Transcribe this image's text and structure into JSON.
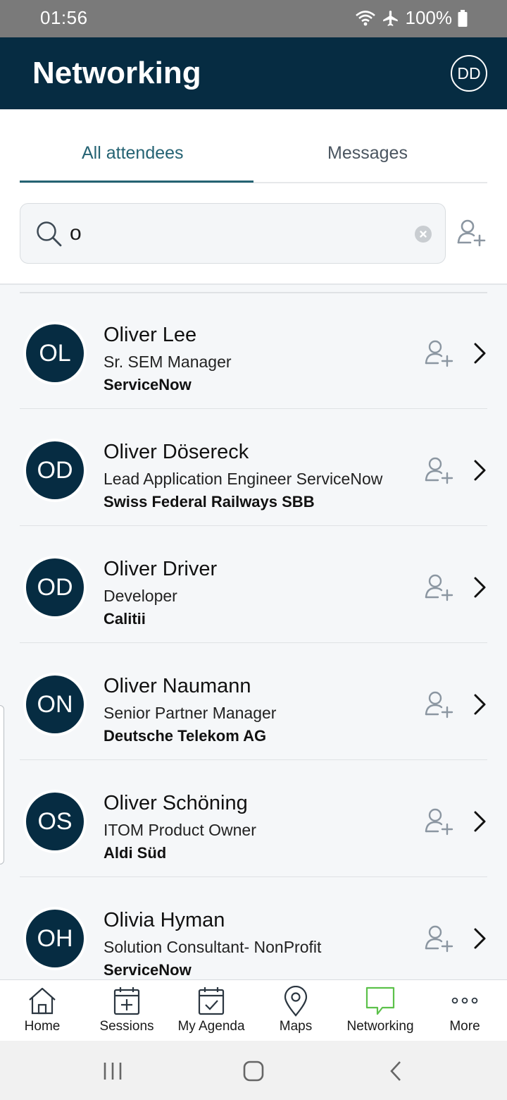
{
  "status_bar": {
    "time": "01:56",
    "battery": "100%"
  },
  "header": {
    "title": "Networking",
    "avatar_initials": "DD"
  },
  "tabs": [
    {
      "label": "All attendees",
      "active": true
    },
    {
      "label": "Messages",
      "active": false
    }
  ],
  "search": {
    "value": "o",
    "placeholder": ""
  },
  "attendees": [
    {
      "initials": "OL",
      "name": "Oliver Lee",
      "role": "Sr. SEM Manager",
      "company": "ServiceNow"
    },
    {
      "initials": "OD",
      "name": "Oliver Dösereck",
      "role": "Lead Application Engineer ServiceNow",
      "company": "Swiss Federal Railways SBB"
    },
    {
      "initials": "OD",
      "name": "Oliver Driver",
      "role": "Developer",
      "company": "Calitii"
    },
    {
      "initials": "ON",
      "name": "Oliver Naumann",
      "role": "Senior Partner Manager",
      "company": "Deutsche Telekom AG"
    },
    {
      "initials": "OS",
      "name": "Oliver Schöning",
      "role": "ITOM Product Owner",
      "company": "Aldi Süd"
    },
    {
      "initials": "OH",
      "name": "Olivia Hyman",
      "role": "Solution Consultant- NonProfit",
      "company": "ServiceNow"
    }
  ],
  "bottom_nav": [
    {
      "label": "Home",
      "icon": "home-icon",
      "active": false
    },
    {
      "label": "Sessions",
      "icon": "calendar-plus-icon",
      "active": false
    },
    {
      "label": "My Agenda",
      "icon": "calendar-check-icon",
      "active": false
    },
    {
      "label": "Maps",
      "icon": "map-pin-icon",
      "active": false
    },
    {
      "label": "Networking",
      "icon": "chat-bubble-icon",
      "active": true
    },
    {
      "label": "More",
      "icon": "more-dots-icon",
      "active": false
    }
  ],
  "colors": {
    "primary": "#062c42",
    "accent": "#256373",
    "active_nav": "#5cc14a"
  }
}
